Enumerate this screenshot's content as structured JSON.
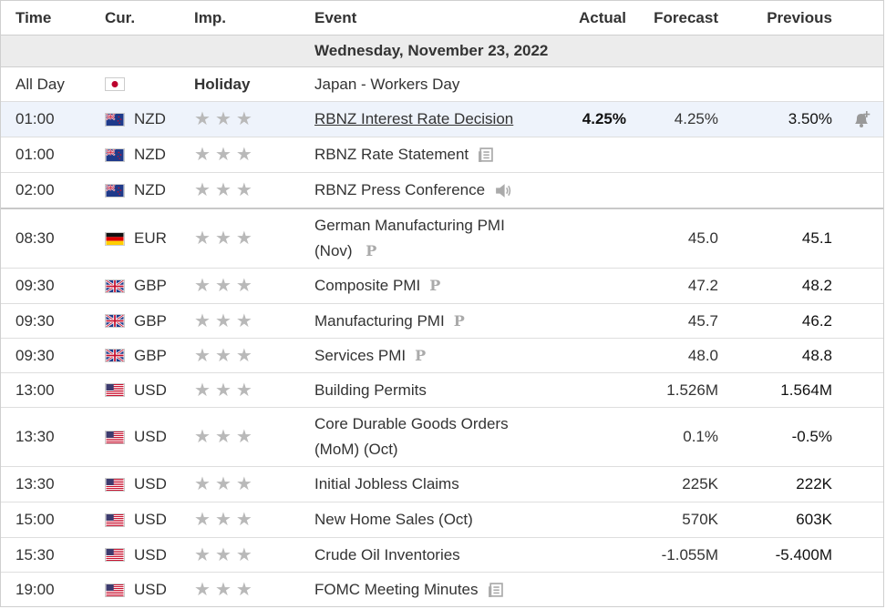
{
  "header": {
    "time": "Time",
    "currency": "Cur.",
    "importance": "Imp.",
    "event": "Event",
    "actual": "Actual",
    "forecast": "Forecast",
    "previous": "Previous"
  },
  "date_label": "Wednesday, November 23, 2022",
  "holiday": {
    "time": "All Day",
    "importance": "Holiday",
    "event": "Japan - Workers Day"
  },
  "rows": [
    {
      "time": "01:00",
      "currency": "NZD",
      "event": "RBNZ Interest Rate Decision",
      "actual": "4.25%",
      "forecast": "4.25%",
      "previous": "3.50%"
    },
    {
      "time": "01:00",
      "currency": "NZD",
      "event": "RBNZ Rate Statement",
      "actual": "",
      "forecast": "",
      "previous": ""
    },
    {
      "time": "02:00",
      "currency": "NZD",
      "event": "RBNZ Press Conference",
      "actual": "",
      "forecast": "",
      "previous": ""
    },
    {
      "time": "08:30",
      "currency": "EUR",
      "event": "German Manufacturing PMI",
      "event_line2": "(Nov)",
      "actual": "",
      "forecast": "45.0",
      "previous": "45.1"
    },
    {
      "time": "09:30",
      "currency": "GBP",
      "event": "Composite PMI",
      "actual": "",
      "forecast": "47.2",
      "previous": "48.2"
    },
    {
      "time": "09:30",
      "currency": "GBP",
      "event": "Manufacturing PMI",
      "actual": "",
      "forecast": "45.7",
      "previous": "46.2"
    },
    {
      "time": "09:30",
      "currency": "GBP",
      "event": "Services PMI",
      "actual": "",
      "forecast": "48.0",
      "previous": "48.8"
    },
    {
      "time": "13:00",
      "currency": "USD",
      "event": "Building Permits",
      "actual": "",
      "forecast": "1.526M",
      "previous": "1.564M"
    },
    {
      "time": "13:30",
      "currency": "USD",
      "event": "Core Durable Goods Orders",
      "event_line2": "(MoM) (Oct)",
      "actual": "",
      "forecast": "0.1%",
      "previous": "-0.5%"
    },
    {
      "time": "13:30",
      "currency": "USD",
      "event": "Initial Jobless Claims",
      "actual": "",
      "forecast": "225K",
      "previous": "222K"
    },
    {
      "time": "15:00",
      "currency": "USD",
      "event": "New Home Sales (Oct)",
      "actual": "",
      "forecast": "570K",
      "previous": "603K"
    },
    {
      "time": "15:30",
      "currency": "USD",
      "event": "Crude Oil Inventories",
      "actual": "",
      "forecast": "-1.055M",
      "previous": "-5.400M"
    },
    {
      "time": "19:00",
      "currency": "USD",
      "event": "FOMC Meeting Minutes",
      "actual": "",
      "forecast": "",
      "previous": ""
    }
  ],
  "icons": {
    "report": "report-icon",
    "speaker": "speaker-icon",
    "preliminary": "P",
    "alert": "bell-alert-icon",
    "flags": [
      "japan-flag-icon",
      "new-zealand-flag-icon",
      "germany-flag-icon",
      "uk-flag-icon",
      "usa-flag-icon"
    ]
  },
  "colors": {
    "highlight_row": "#eef3fb",
    "date_row": "#ececec",
    "star_inactive": "#b9b9b9"
  }
}
